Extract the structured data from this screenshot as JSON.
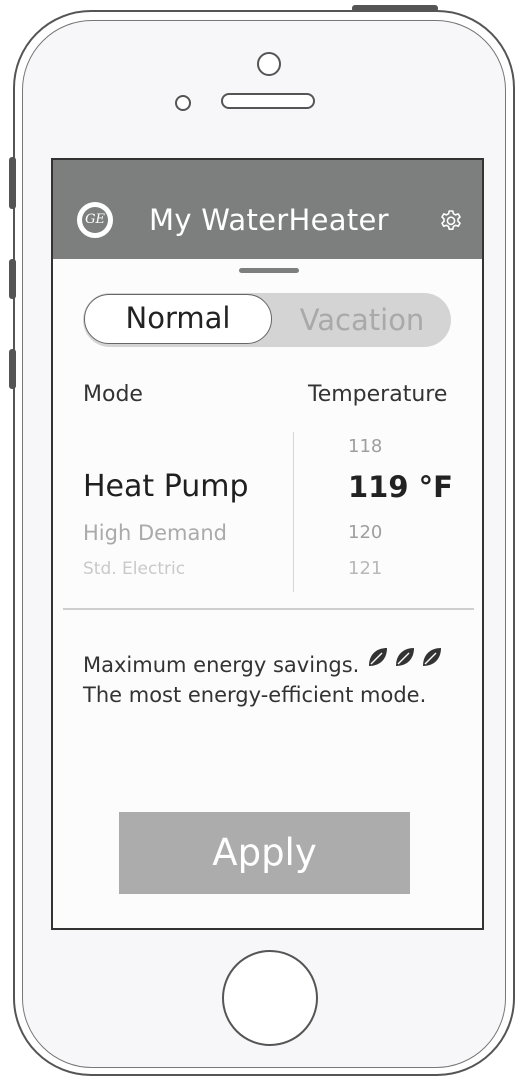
{
  "app": {
    "title": "My WaterHeater",
    "logo_text": "GE"
  },
  "tabs": {
    "normal": "Normal",
    "vacation": "Vacation",
    "selected": "Normal"
  },
  "labels": {
    "mode": "Mode",
    "temperature": "Temperature"
  },
  "mode_picker": {
    "selected": "Heat Pump",
    "below_1": "High Demand",
    "below_2": "Std. Electric"
  },
  "temperature_picker": {
    "above": "118",
    "selected": "119 °F",
    "below_1": "120",
    "below_2": "121"
  },
  "description": {
    "line1": "Maximum energy savings.",
    "line2": "The most energy-efficient mode.",
    "leaf_icon": "leaf-icon"
  },
  "actions": {
    "apply": "Apply"
  },
  "colors": {
    "header": "#7d7f7e",
    "apply_button": "#acacac",
    "toggle_track": "#d4d4d4"
  }
}
